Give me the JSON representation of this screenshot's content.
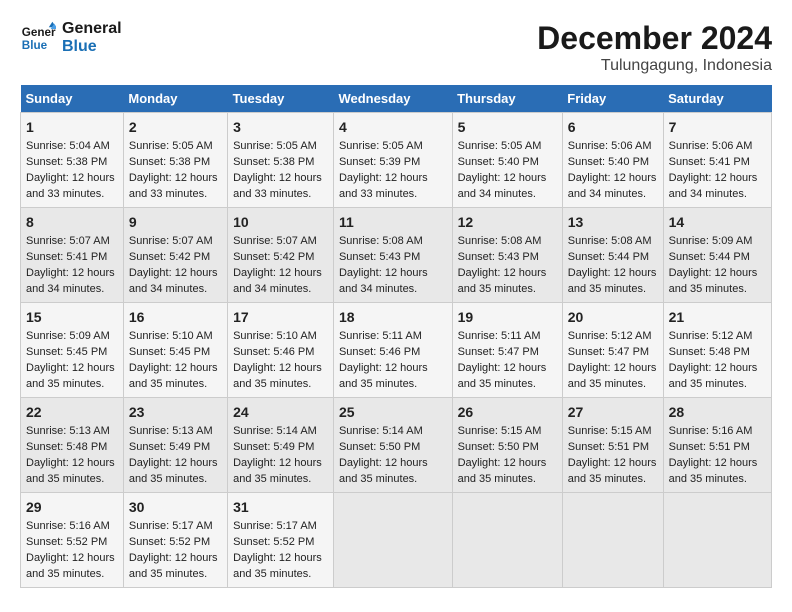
{
  "logo": {
    "line1": "General",
    "line2": "Blue"
  },
  "title": "December 2024",
  "subtitle": "Tulungagung, Indonesia",
  "days_header": [
    "Sunday",
    "Monday",
    "Tuesday",
    "Wednesday",
    "Thursday",
    "Friday",
    "Saturday"
  ],
  "weeks": [
    [
      {
        "day": "1",
        "sunrise": "5:04 AM",
        "sunset": "5:38 PM",
        "daylight": "12 hours and 33 minutes."
      },
      {
        "day": "2",
        "sunrise": "5:05 AM",
        "sunset": "5:38 PM",
        "daylight": "12 hours and 33 minutes."
      },
      {
        "day": "3",
        "sunrise": "5:05 AM",
        "sunset": "5:38 PM",
        "daylight": "12 hours and 33 minutes."
      },
      {
        "day": "4",
        "sunrise": "5:05 AM",
        "sunset": "5:39 PM",
        "daylight": "12 hours and 33 minutes."
      },
      {
        "day": "5",
        "sunrise": "5:05 AM",
        "sunset": "5:40 PM",
        "daylight": "12 hours and 34 minutes."
      },
      {
        "day": "6",
        "sunrise": "5:06 AM",
        "sunset": "5:40 PM",
        "daylight": "12 hours and 34 minutes."
      },
      {
        "day": "7",
        "sunrise": "5:06 AM",
        "sunset": "5:41 PM",
        "daylight": "12 hours and 34 minutes."
      }
    ],
    [
      {
        "day": "8",
        "sunrise": "5:07 AM",
        "sunset": "5:41 PM",
        "daylight": "12 hours and 34 minutes."
      },
      {
        "day": "9",
        "sunrise": "5:07 AM",
        "sunset": "5:42 PM",
        "daylight": "12 hours and 34 minutes."
      },
      {
        "day": "10",
        "sunrise": "5:07 AM",
        "sunset": "5:42 PM",
        "daylight": "12 hours and 34 minutes."
      },
      {
        "day": "11",
        "sunrise": "5:08 AM",
        "sunset": "5:43 PM",
        "daylight": "12 hours and 34 minutes."
      },
      {
        "day": "12",
        "sunrise": "5:08 AM",
        "sunset": "5:43 PM",
        "daylight": "12 hours and 35 minutes."
      },
      {
        "day": "13",
        "sunrise": "5:08 AM",
        "sunset": "5:44 PM",
        "daylight": "12 hours and 35 minutes."
      },
      {
        "day": "14",
        "sunrise": "5:09 AM",
        "sunset": "5:44 PM",
        "daylight": "12 hours and 35 minutes."
      }
    ],
    [
      {
        "day": "15",
        "sunrise": "5:09 AM",
        "sunset": "5:45 PM",
        "daylight": "12 hours and 35 minutes."
      },
      {
        "day": "16",
        "sunrise": "5:10 AM",
        "sunset": "5:45 PM",
        "daylight": "12 hours and 35 minutes."
      },
      {
        "day": "17",
        "sunrise": "5:10 AM",
        "sunset": "5:46 PM",
        "daylight": "12 hours and 35 minutes."
      },
      {
        "day": "18",
        "sunrise": "5:11 AM",
        "sunset": "5:46 PM",
        "daylight": "12 hours and 35 minutes."
      },
      {
        "day": "19",
        "sunrise": "5:11 AM",
        "sunset": "5:47 PM",
        "daylight": "12 hours and 35 minutes."
      },
      {
        "day": "20",
        "sunrise": "5:12 AM",
        "sunset": "5:47 PM",
        "daylight": "12 hours and 35 minutes."
      },
      {
        "day": "21",
        "sunrise": "5:12 AM",
        "sunset": "5:48 PM",
        "daylight": "12 hours and 35 minutes."
      }
    ],
    [
      {
        "day": "22",
        "sunrise": "5:13 AM",
        "sunset": "5:48 PM",
        "daylight": "12 hours and 35 minutes."
      },
      {
        "day": "23",
        "sunrise": "5:13 AM",
        "sunset": "5:49 PM",
        "daylight": "12 hours and 35 minutes."
      },
      {
        "day": "24",
        "sunrise": "5:14 AM",
        "sunset": "5:49 PM",
        "daylight": "12 hours and 35 minutes."
      },
      {
        "day": "25",
        "sunrise": "5:14 AM",
        "sunset": "5:50 PM",
        "daylight": "12 hours and 35 minutes."
      },
      {
        "day": "26",
        "sunrise": "5:15 AM",
        "sunset": "5:50 PM",
        "daylight": "12 hours and 35 minutes."
      },
      {
        "day": "27",
        "sunrise": "5:15 AM",
        "sunset": "5:51 PM",
        "daylight": "12 hours and 35 minutes."
      },
      {
        "day": "28",
        "sunrise": "5:16 AM",
        "sunset": "5:51 PM",
        "daylight": "12 hours and 35 minutes."
      }
    ],
    [
      {
        "day": "29",
        "sunrise": "5:16 AM",
        "sunset": "5:52 PM",
        "daylight": "12 hours and 35 minutes."
      },
      {
        "day": "30",
        "sunrise": "5:17 AM",
        "sunset": "5:52 PM",
        "daylight": "12 hours and 35 minutes."
      },
      {
        "day": "31",
        "sunrise": "5:17 AM",
        "sunset": "5:52 PM",
        "daylight": "12 hours and 35 minutes."
      },
      null,
      null,
      null,
      null
    ]
  ]
}
